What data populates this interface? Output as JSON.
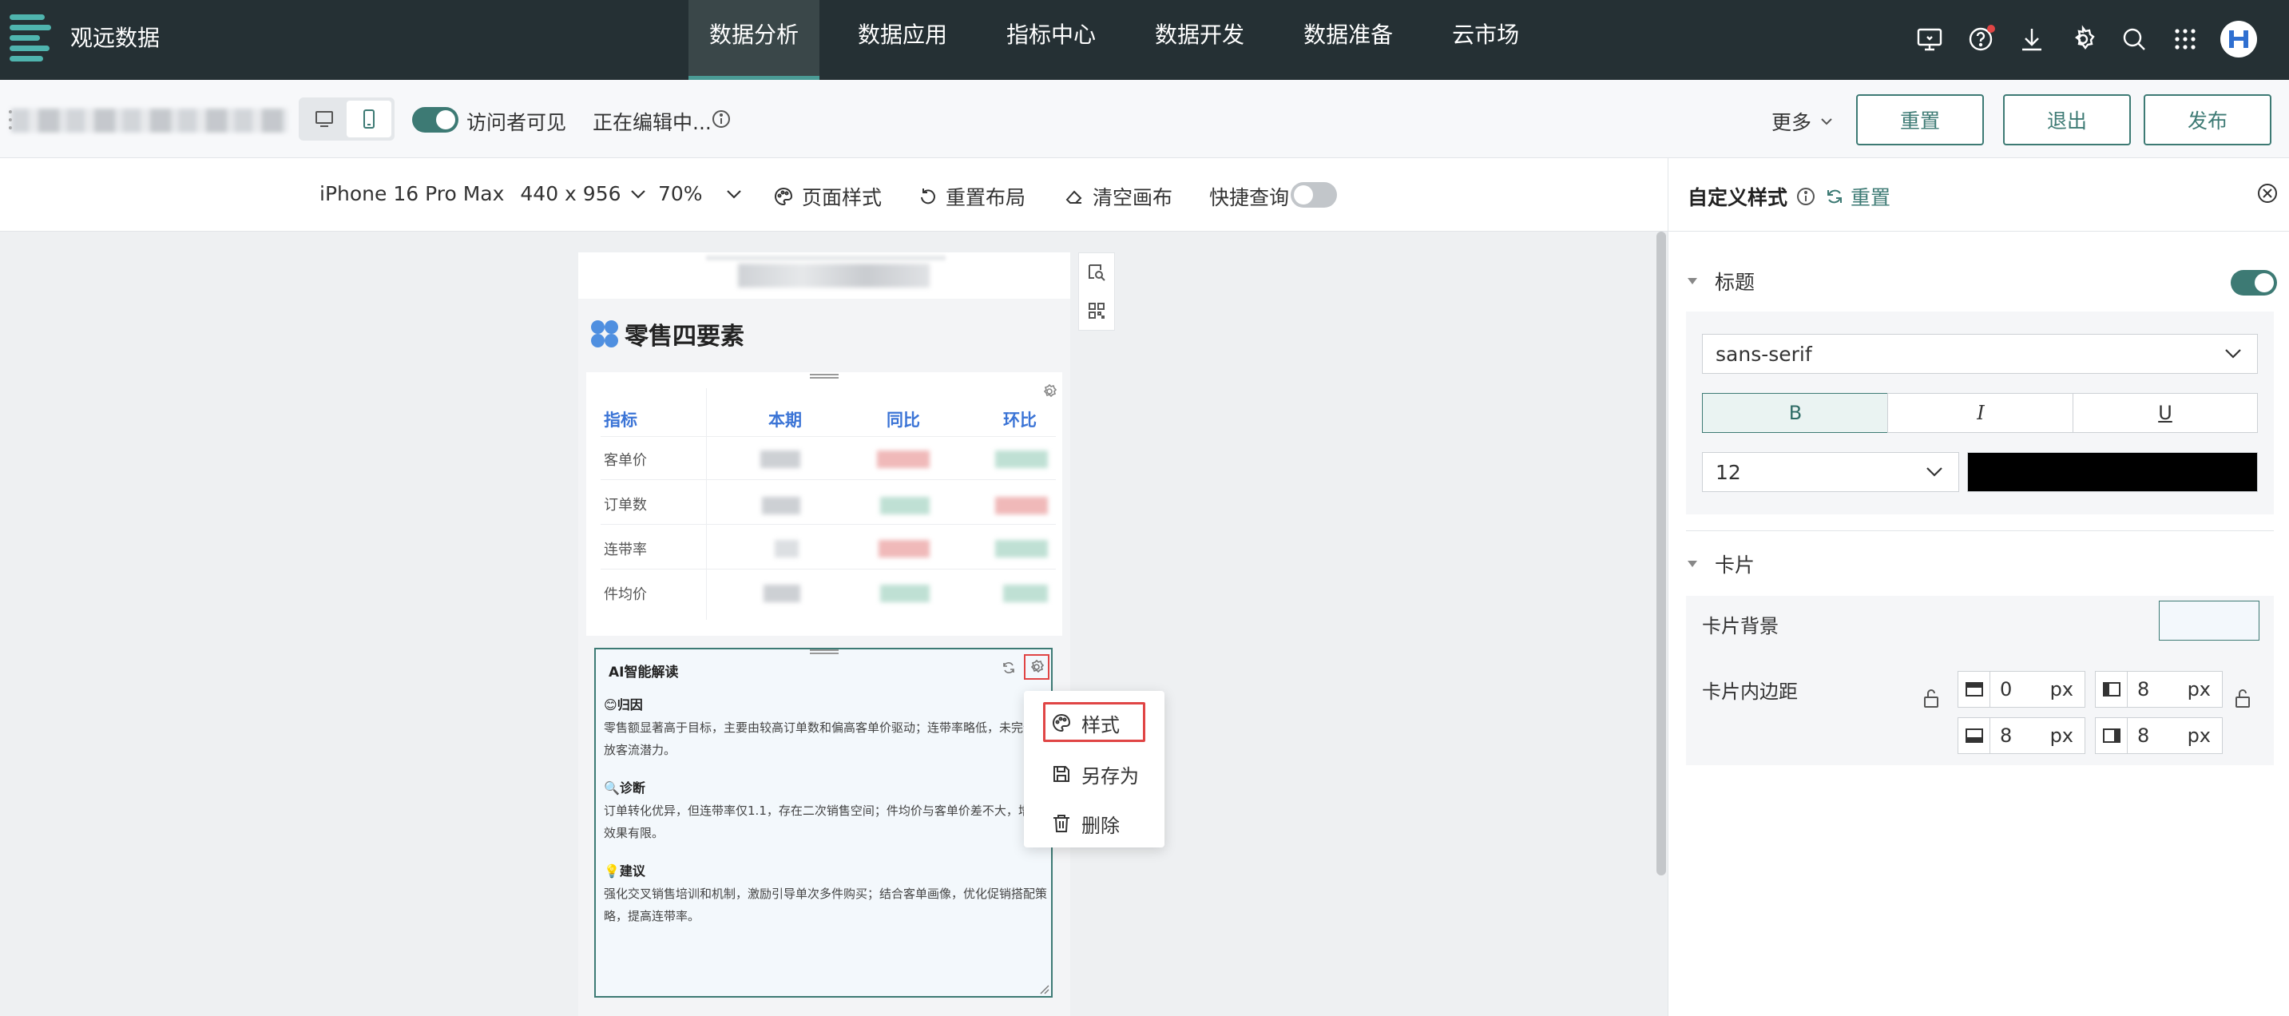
{
  "topnav": {
    "app_title": "观远数据",
    "tabs": [
      {
        "label": "数据分析",
        "active": true
      },
      {
        "label": "数据应用"
      },
      {
        "label": "指标中心"
      },
      {
        "label": "数据开发"
      },
      {
        "label": "数据准备"
      },
      {
        "label": "云市场"
      }
    ],
    "icons": [
      "screen-icon",
      "help-icon",
      "download-icon",
      "settings-icon",
      "search-icon",
      "apps-grid-icon"
    ]
  },
  "toolbar": {
    "visitor_label": "访问者可见",
    "editing_status": "正在编辑中...",
    "more_label": "更多",
    "reset_label": "重置",
    "exit_label": "退出",
    "publish_label": "发布"
  },
  "canvas_bar": {
    "device": "iPhone 16 Pro Max",
    "resolution": "440 x 956",
    "zoom": "70%",
    "page_style": "页面样式",
    "reset_layout": "重置布局",
    "clear_canvas": "清空画布",
    "quick_query": "快捷查询"
  },
  "phone": {
    "report_title": "零售四要素",
    "table": {
      "headers": [
        "指标",
        "本期",
        "同比",
        "环比"
      ],
      "rows": [
        "客单价",
        "订单数",
        "连带率",
        "件均价"
      ]
    },
    "ai_card": {
      "title": "AI智能解读",
      "sections": [
        {
          "icon": "😊",
          "head": "归因",
          "text": "零售额显著高于目标，主要由较高订单数和偏高客单价驱动；连带率略低，未完全释放客流潜力。"
        },
        {
          "icon": "🔍",
          "head": "诊断",
          "text": "订单转化优异，但连带率仅1.1，存在二次销售空间；件均价与客单价差不大，增购效果有限。"
        },
        {
          "icon": "💡",
          "head": "建议",
          "text": "强化交叉销售培训和机制，激励引导单次多件购买；结合客单画像，优化促销搭配策略，提高连带率。"
        }
      ]
    }
  },
  "context_menu": {
    "items": [
      {
        "label": "样式",
        "icon": "palette-icon"
      },
      {
        "label": "另存为",
        "icon": "save-as-icon"
      },
      {
        "label": "删除",
        "icon": "trash-icon"
      }
    ]
  },
  "right_panel": {
    "title": "自定义样式",
    "reset_label": "重置",
    "title_section": {
      "label": "标题",
      "font": "sans-serif",
      "bold": "B",
      "italic": "I",
      "underline": "U",
      "font_size": "12",
      "color": "#000000"
    },
    "card_section": {
      "label": "卡片",
      "bg_label": "卡片背景",
      "padding_label": "卡片内边距",
      "padding": {
        "top": "0",
        "left": "8",
        "bottom": "8",
        "right": "8"
      },
      "unit": "px"
    }
  },
  "colors": {
    "nav_bg": "#253034",
    "accent": "#3d7a74",
    "highlight_red": "#e04545",
    "table_head_blue": "#3b74d6"
  }
}
